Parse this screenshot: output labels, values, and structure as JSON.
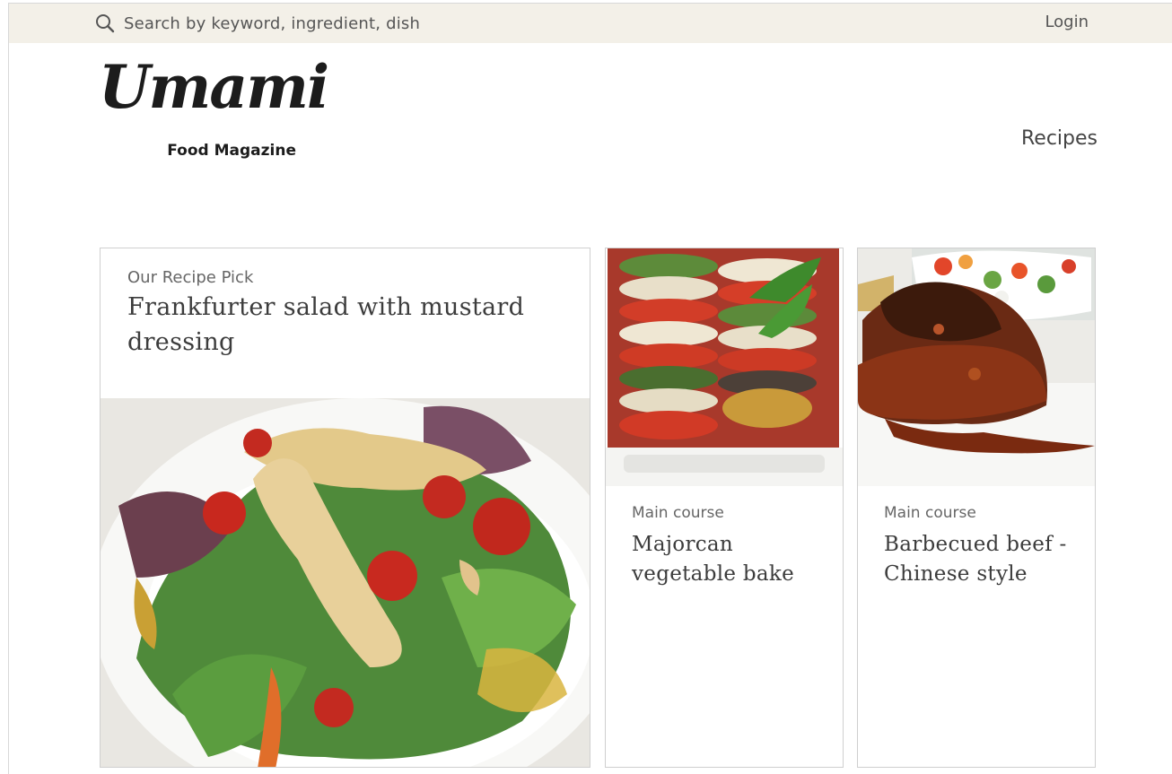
{
  "topbar": {
    "search_icon": "search-icon",
    "search_placeholder": "Search by keyword, ingredient, dish",
    "login_label": "Login"
  },
  "brand": {
    "name": "Umami",
    "tagline": "Food Magazine"
  },
  "nav": {
    "recipes_label": "Recipes"
  },
  "featured": {
    "kicker": "Our Recipe Pick",
    "title": "Frankfurter salad with mustard dressing"
  },
  "cards": [
    {
      "kicker": "Main course",
      "title": "Majorcan vegetable bake"
    },
    {
      "kicker": "Main course",
      "title": "Barbecued beef - Chinese style"
    }
  ],
  "colors": {
    "topbar_bg": "#f3f0e8",
    "card_border": "#cfcfcf",
    "text_dark": "#3c3c3c",
    "text_muted": "#666666"
  }
}
